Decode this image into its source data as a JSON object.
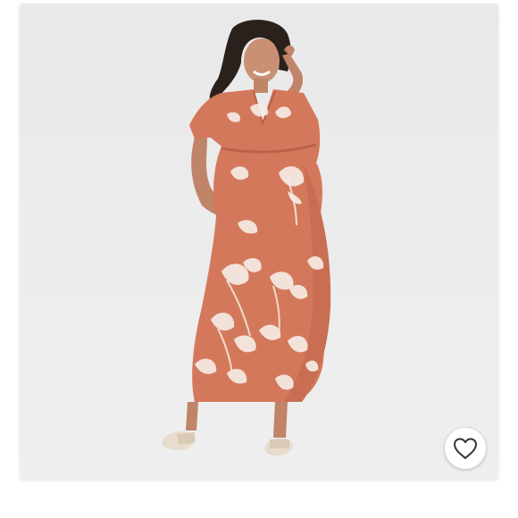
{
  "product": {
    "image_alt": "",
    "dress_color": "#d4785c",
    "print_color": "#f6ece4",
    "background_color": "#ececec"
  },
  "favorite": {
    "icon": "heart-outline-icon",
    "state": "not-favorited"
  }
}
